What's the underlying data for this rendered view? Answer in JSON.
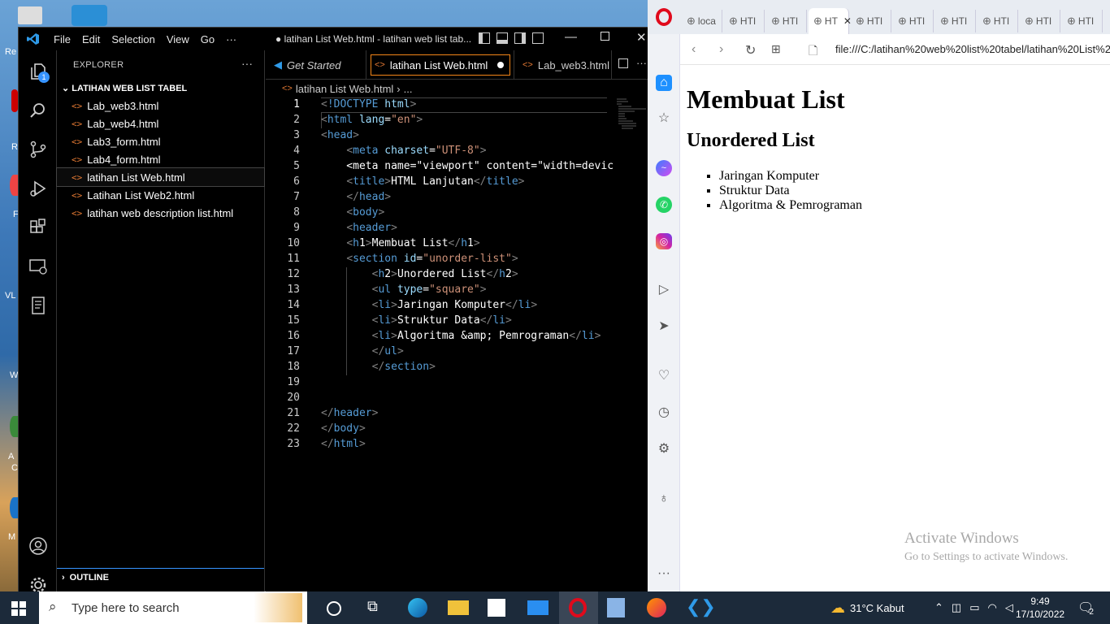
{
  "vscode": {
    "menu": [
      "File",
      "Edit",
      "Selection",
      "View",
      "Go",
      "···"
    ],
    "window_title": "● latihan List Web.html - latihan web list tab...",
    "explorer_title": "EXPLORER",
    "folder_name": "LATIHAN WEB LIST TABEL",
    "files": [
      "Lab_web3.html",
      "Lab_web4.html",
      "Lab3_form.html",
      "Lab4_form.html",
      "latihan List Web.html",
      "Latihan List Web2.html",
      "latihan web description list.html"
    ],
    "active_file_index": 4,
    "outline_label": "OUTLINE",
    "explorer_badge": "1",
    "tabs": [
      {
        "label": "Get Started"
      },
      {
        "label": "latihan List Web.html"
      },
      {
        "label": "Lab_web3.html"
      }
    ],
    "breadcrumb": [
      "latihan List Web.html",
      "..."
    ],
    "code_lines": [
      {
        "n": "1"
      },
      {
        "n": "2"
      },
      {
        "n": "3"
      },
      {
        "n": "4"
      },
      {
        "n": "5"
      },
      {
        "n": "6"
      },
      {
        "n": "7"
      },
      {
        "n": "8"
      },
      {
        "n": "9"
      },
      {
        "n": "10"
      },
      {
        "n": "11"
      },
      {
        "n": "12"
      },
      {
        "n": "13"
      },
      {
        "n": "14"
      },
      {
        "n": "15"
      },
      {
        "n": "16"
      },
      {
        "n": "17"
      },
      {
        "n": "18"
      },
      {
        "n": "19"
      },
      {
        "n": "20"
      },
      {
        "n": "21"
      },
      {
        "n": "22"
      },
      {
        "n": "23"
      }
    ],
    "code_text": {
      "l1": "<!DOCTYPE html>",
      "l2": "<html lang=\"en\">",
      "l3": "<head>",
      "l4": "    <meta charset=\"UTF-8\">",
      "l5": "    <meta name=\"viewport\" content=\"width=devic",
      "l6": "    <title>HTML Lanjutan</title>",
      "l7": "    </head>",
      "l8": "    <body>",
      "l9": "    <header>",
      "l10": "    <h1>Membuat List</h1>",
      "l11": "    <section id=\"unorder-list\">",
      "l12": "        <h2>Unordered List</h2>",
      "l13": "        <ul type=\"square\">",
      "l14": "        <li>Jaringan Komputer</li>",
      "l15": "        <li>Struktur Data</li>",
      "l16": "        <li>Algoritma &amp; Pemrograman</li>",
      "l17": "        </ul>",
      "l18": "        </section>",
      "l21": "</header>",
      "l22": "</body>",
      "l23": "</html>"
    }
  },
  "browser": {
    "tabs": [
      "loca",
      "HTI",
      "HTI",
      "HT",
      "HTI",
      "HTI",
      "HTI",
      "HTI",
      "HTI",
      "HTI"
    ],
    "url": "file:///C:/latihan%20web%20list%20tabel/latihan%20List%2",
    "page": {
      "h1": "Membuat List",
      "h2": "Unordered List",
      "items": [
        "Jaringan Komputer",
        "Struktur Data",
        "Algoritma & Pemrograman"
      ]
    },
    "activate_title": "Activate Windows",
    "activate_sub": "Go to Settings to activate Windows."
  },
  "taskbar": {
    "search_placeholder": "Type here to search",
    "weather": "31°C  Kabut",
    "time": "9:49",
    "date": "17/10/2022",
    "notif_count": "2"
  },
  "desktop_labels": [
    "Re",
    "R",
    "F",
    "VL",
    "W",
    "A",
    "C",
    "M"
  ],
  "colors": {
    "vscode_bg": "#000000",
    "tag": "#569cd6",
    "attr": "#9cdcfe",
    "string": "#ce9178",
    "opera_red": "#e00a1c",
    "accent": "#3794ff"
  }
}
